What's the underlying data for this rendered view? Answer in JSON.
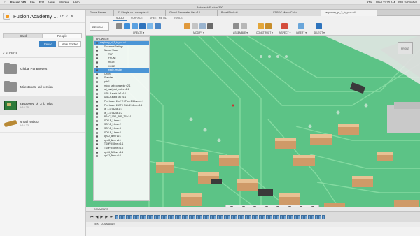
{
  "os_menu": {
    "apple": "",
    "items": [
      "Fusion 360",
      "File",
      "Edit",
      "View",
      "Window",
      "Help"
    ],
    "right": [
      "97%",
      "Wed 11:20 AM",
      "Phil Schmidler"
    ]
  },
  "window_title": "Autodesk Fusion 360",
  "left_panel": {
    "title": "Fusion Academy ...",
    "tabs": [
      "Card",
      "People"
    ],
    "upload": "Upload",
    "new_folder": "New Folder",
    "breadcrumb": "AU 2018",
    "items": [
      {
        "name": "Global Parameters",
        "sub": "",
        "thumb": "folder"
      },
      {
        "name": "Milestones - all version",
        "sub": "",
        "thumb": "folder"
      },
      {
        "name": "raspberry_pi_3_b_plus",
        "sub": "V16 75",
        "thumb": "pcb"
      },
      {
        "name": "small resistor",
        "sub": "V16 73",
        "thumb": "resistor"
      }
    ]
  },
  "doc_tabs": [
    {
      "label": "Global Param...",
      "selected": false
    },
    {
      "label": "02 Simple co...example v2",
      "selected": false
    },
    {
      "label": "Global Parameter List v14",
      "selected": false
    },
    {
      "label": "BoardShell v5",
      "selected": false
    },
    {
      "label": "02 BKC Mono-Cal v1",
      "selected": false
    },
    {
      "label": "raspberry_pi_3_b_plus v4",
      "selected": true
    }
  ],
  "workspace_tabs": [
    "SOLID",
    "SURFACE",
    "SHEET METAL",
    "TOOLS"
  ],
  "design_dropdown": "DESIGN ▾",
  "toolbar_groups": [
    {
      "label": "CREATE ▾"
    },
    {
      "label": "MODIFY ▾"
    },
    {
      "label": "ASSEMBLE ▾"
    },
    {
      "label": "CONSTRUCT ▾"
    },
    {
      "label": "INSPECT ▾"
    },
    {
      "label": "INSERT ▾"
    },
    {
      "label": "SELECT ▾"
    }
  ],
  "browser": {
    "header": "BROWSER",
    "rows": [
      {
        "label": "raspberry_pi_3_b_plus v4",
        "indent": 0,
        "selected": true
      },
      {
        "label": "Document Settings",
        "indent": 1
      },
      {
        "label": "Named Views",
        "indent": 1
      },
      {
        "label": "TOP",
        "indent": 2
      },
      {
        "label": "FRONT",
        "indent": 2
      },
      {
        "label": "RIGHT",
        "indent": 2
      },
      {
        "label": "HOME",
        "indent": 2
      },
      {
        "label": "eagle-version",
        "indent": 2,
        "selected": true
      },
      {
        "label": "Origin",
        "indent": 1
      },
      {
        "label": "Sketches",
        "indent": 1
      },
      {
        "label": "pcb:1",
        "indent": 1
      },
      {
        "label": "micro_usb_connector v2:1",
        "indent": 1
      },
      {
        "label": "sd_card_slot_molex v2:1",
        "indent": 1
      },
      {
        "label": "USB-A-stack 1x2 v1:1",
        "indent": 1
      },
      {
        "label": "USB-A-stack 1x2 v1:1",
        "indent": 1
      },
      {
        "label": "Pin Header 20x2 TH Pitch 2.54mm v1:1",
        "indent": 1
      },
      {
        "label": "Pin Header 2x2 TH Pitch 2.54mm v1:1",
        "indent": 1
      },
      {
        "label": "la_1-1734248-1 :1",
        "indent": 1
      },
      {
        "label": "la_1-1734248-1 :2",
        "indent": 1
      },
      {
        "label": "BSAC_1761_BFR_TR v1:1",
        "indent": 1
      },
      {
        "label": "SOP-8_1.6mm:1",
        "indent": 1
      },
      {
        "label": "SOP-8_1.6mm:2",
        "indent": 1
      },
      {
        "label": "SOP-8_1.6mm:3",
        "indent": 1
      },
      {
        "label": "SOP-8_1.6mm:4",
        "indent": 1
      },
      {
        "label": "qfn32_5mm v1:1",
        "indent": 1
      },
      {
        "label": "qfn48_6mm v1:1",
        "indent": 1
      },
      {
        "label": "TSOP-II_8mm v1:1",
        "indent": 1
      },
      {
        "label": "TSOP-II_8mm v1:2",
        "indent": 1
      },
      {
        "label": "qfn16_3x3mm v1:1",
        "indent": 1
      },
      {
        "label": "qfn32_5mm v1:2",
        "indent": 1
      }
    ]
  },
  "navcube_label": "FRONT",
  "comments_label": "COMMENTS",
  "text_commands_label": "TEXT COMMANDS",
  "timeline_features": 60
}
